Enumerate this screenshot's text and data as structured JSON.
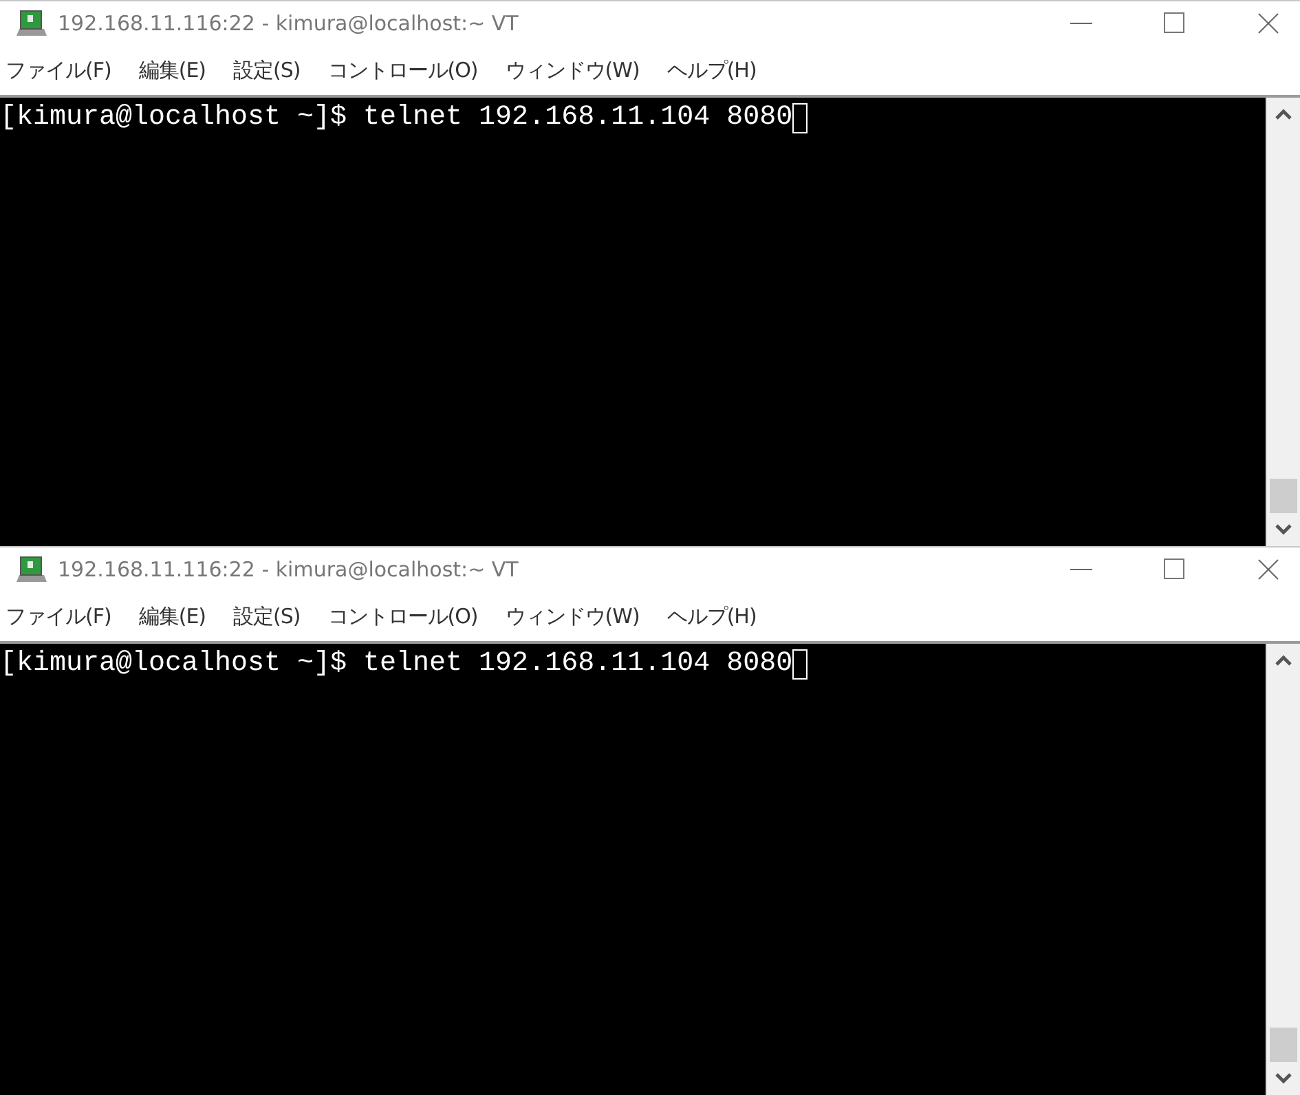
{
  "windows": [
    {
      "title": "192.168.11.116:22 - kimura@localhost:~ VT",
      "menu": [
        "ファイル(F)",
        "編集(E)",
        "設定(S)",
        "コントロール(O)",
        "ウィンドウ(W)",
        "ヘルプ(H)"
      ],
      "terminal": {
        "lines": [
          "[kimura@localhost ~]$ telnet 192.168.11.104 8080"
        ]
      }
    },
    {
      "title": "192.168.11.116:22 - kimura@localhost:~ VT",
      "menu": [
        "ファイル(F)",
        "編集(E)",
        "設定(S)",
        "コントロール(O)",
        "ウィンドウ(W)",
        "ヘルプ(H)"
      ],
      "terminal": {
        "lines": [
          "[kimura@localhost ~]$ telnet 192.168.11.104 8080"
        ]
      }
    }
  ]
}
